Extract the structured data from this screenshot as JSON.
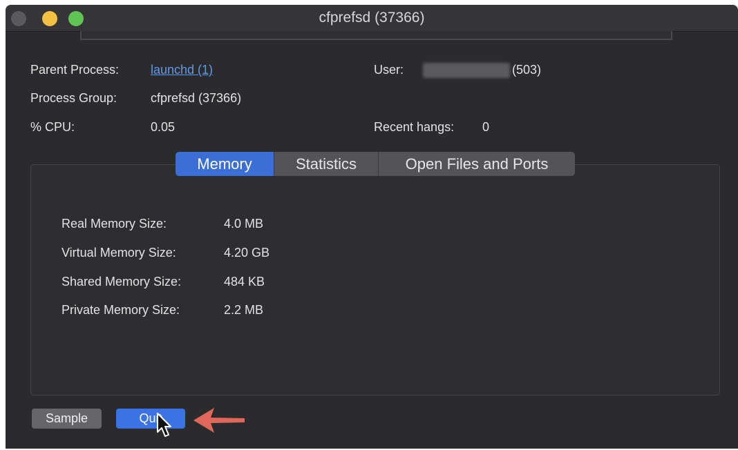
{
  "window": {
    "title": "cfprefsd (37366)"
  },
  "info": {
    "parent_process_label": "Parent Process:",
    "parent_process_value": "launchd (1)",
    "process_group_label": "Process Group:",
    "process_group_value": "cfprefsd (37366)",
    "cpu_label": "% CPU:",
    "cpu_value": "0.05",
    "user_label": "User:",
    "user_value": "(503)",
    "recent_hangs_label": "Recent hangs:",
    "recent_hangs_value": "0"
  },
  "tabs": [
    {
      "label": "Memory",
      "active": true
    },
    {
      "label": "Statistics",
      "active": false
    },
    {
      "label": "Open Files and Ports",
      "active": false
    }
  ],
  "memory": [
    {
      "label": "Real Memory Size:",
      "value": "4.0 MB"
    },
    {
      "label": "Virtual Memory Size:",
      "value": "4.20 GB"
    },
    {
      "label": "Shared Memory Size:",
      "value": "484 KB"
    },
    {
      "label": "Private Memory Size:",
      "value": "2.2 MB"
    }
  ],
  "buttons": {
    "sample": "Sample",
    "quit": "Quit"
  },
  "colors": {
    "window_bg": "#2b2b2d",
    "accent": "#3b73e4",
    "link": "#5c9bf0",
    "annotation_arrow": "#e0685a"
  }
}
